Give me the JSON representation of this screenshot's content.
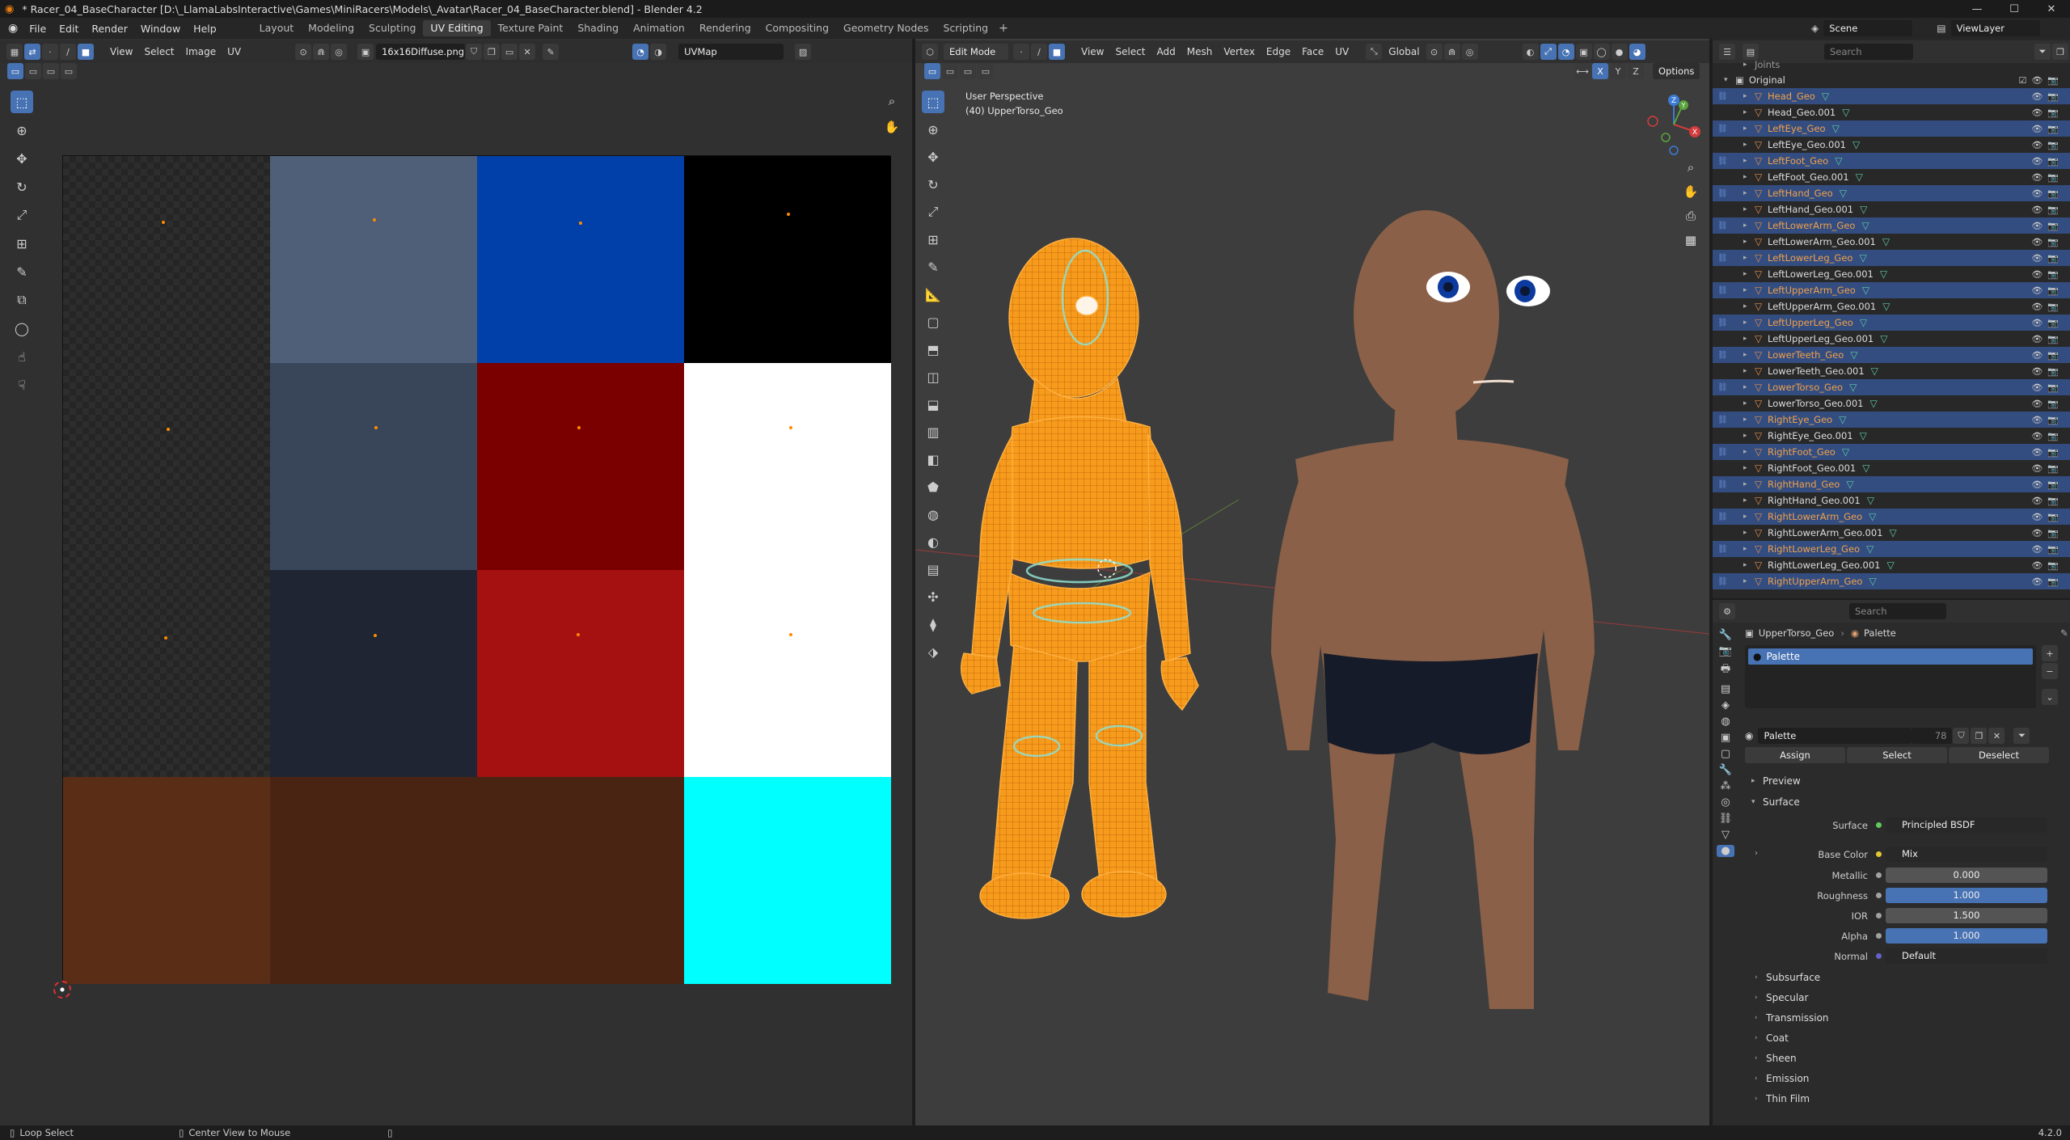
{
  "window": {
    "title": "* Racer_04_BaseCharacter [D:\\_LlamaLabsInteractive\\Games\\MiniRacers\\Models\\_Avatar\\Racer_04_BaseCharacter.blend] - Blender 4.2",
    "minimize": "—",
    "maximize": "☐",
    "close": "✕"
  },
  "menu": [
    "File",
    "Edit",
    "Render",
    "Window",
    "Help"
  ],
  "workspaces": [
    "Layout",
    "Modeling",
    "Sculpting",
    "UV Editing",
    "Texture Paint",
    "Shading",
    "Animation",
    "Rendering",
    "Compositing",
    "Geometry Nodes",
    "Scripting"
  ],
  "active_workspace_index": 3,
  "scene": {
    "label": "Scene",
    "view_layer": "ViewLayer"
  },
  "uv_editor": {
    "menus": [
      "View",
      "Select",
      "Image",
      "UV"
    ],
    "image_name": "16x16Diffuse.png",
    "uv_map": "UVMap",
    "tiles": [
      {
        "color": "checker"
      },
      {
        "color": "#4f5f78"
      },
      {
        "color": "#0140a8"
      },
      {
        "color": "#000000"
      },
      {
        "color": "checker"
      },
      {
        "color": "#39465a"
      },
      {
        "color": "#7a0000"
      },
      {
        "color": "#ffffff"
      },
      {
        "color": "checker"
      },
      {
        "color": "#1f2533"
      },
      {
        "color": "#a51111"
      },
      {
        "color": "#ffffff"
      },
      {
        "color": "#5a2d17"
      },
      {
        "color": "#4a2413"
      },
      {
        "color": "#4a2413"
      },
      {
        "color": "#00ffff"
      }
    ]
  },
  "viewport": {
    "mode": "Edit Mode",
    "menus": [
      "View",
      "Select",
      "Add",
      "Mesh",
      "Vertex",
      "Edge",
      "Face",
      "UV"
    ],
    "orientation": "Global",
    "options_label": "Options",
    "axes": [
      "X",
      "Y",
      "Z"
    ],
    "info_line1": "User Perspective",
    "info_line2": "(40) UpperTorso_Geo"
  },
  "outliner": {
    "search_placeholder": "Search",
    "joints_label": "Joints",
    "collection": "Original",
    "rows": [
      {
        "name": "Head_Geo",
        "sel": true
      },
      {
        "name": "Head_Geo.001",
        "sel": false
      },
      {
        "name": "LeftEye_Geo",
        "sel": true
      },
      {
        "name": "LeftEye_Geo.001",
        "sel": false
      },
      {
        "name": "LeftFoot_Geo",
        "sel": true
      },
      {
        "name": "LeftFoot_Geo.001",
        "sel": false
      },
      {
        "name": "LeftHand_Geo",
        "sel": true
      },
      {
        "name": "LeftHand_Geo.001",
        "sel": false
      },
      {
        "name": "LeftLowerArm_Geo",
        "sel": true
      },
      {
        "name": "LeftLowerArm_Geo.001",
        "sel": false
      },
      {
        "name": "LeftLowerLeg_Geo",
        "sel": true
      },
      {
        "name": "LeftLowerLeg_Geo.001",
        "sel": false
      },
      {
        "name": "LeftUpperArm_Geo",
        "sel": true
      },
      {
        "name": "LeftUpperArm_Geo.001",
        "sel": false
      },
      {
        "name": "LeftUpperLeg_Geo",
        "sel": true
      },
      {
        "name": "LeftUpperLeg_Geo.001",
        "sel": false
      },
      {
        "name": "LowerTeeth_Geo",
        "sel": true
      },
      {
        "name": "LowerTeeth_Geo.001",
        "sel": false
      },
      {
        "name": "LowerTorso_Geo",
        "sel": true
      },
      {
        "name": "LowerTorso_Geo.001",
        "sel": false
      },
      {
        "name": "RightEye_Geo",
        "sel": true
      },
      {
        "name": "RightEye_Geo.001",
        "sel": false
      },
      {
        "name": "RightFoot_Geo",
        "sel": true
      },
      {
        "name": "RightFoot_Geo.001",
        "sel": false
      },
      {
        "name": "RightHand_Geo",
        "sel": true
      },
      {
        "name": "RightHand_Geo.001",
        "sel": false
      },
      {
        "name": "RightLowerArm_Geo",
        "sel": true
      },
      {
        "name": "RightLowerArm_Geo.001",
        "sel": false
      },
      {
        "name": "RightLowerLeg_Geo",
        "sel": true
      },
      {
        "name": "RightLowerLeg_Geo.001",
        "sel": false
      },
      {
        "name": "RightUpperArm_Geo",
        "sel": true
      }
    ]
  },
  "properties": {
    "search_placeholder": "Search",
    "breadcrumb_object": "UpperTorso_Geo",
    "breadcrumb_material": "Palette",
    "slot_name": "Palette",
    "material_name": "Palette",
    "users": "78",
    "assign": "Assign",
    "select": "Select",
    "deselect": "Deselect",
    "preview": "Preview",
    "surface_panel": "Surface",
    "surface_label": "Surface",
    "surface_value": "Principled BSDF",
    "base_color_label": "Base Color",
    "base_color_value": "Mix",
    "metallic_label": "Metallic",
    "metallic_value": "0.000",
    "roughness_label": "Roughness",
    "roughness_value": "1.000",
    "ior_label": "IOR",
    "ior_value": "1.500",
    "alpha_label": "Alpha",
    "alpha_value": "1.000",
    "normal_label": "Normal",
    "normal_value": "Default",
    "subpanels": [
      "Subsurface",
      "Specular",
      "Transmission",
      "Coat",
      "Sheen",
      "Emission",
      "Thin Film"
    ]
  },
  "status": {
    "left": "Loop Select",
    "mid": "Center View to Mouse",
    "version": "4.2.0"
  }
}
